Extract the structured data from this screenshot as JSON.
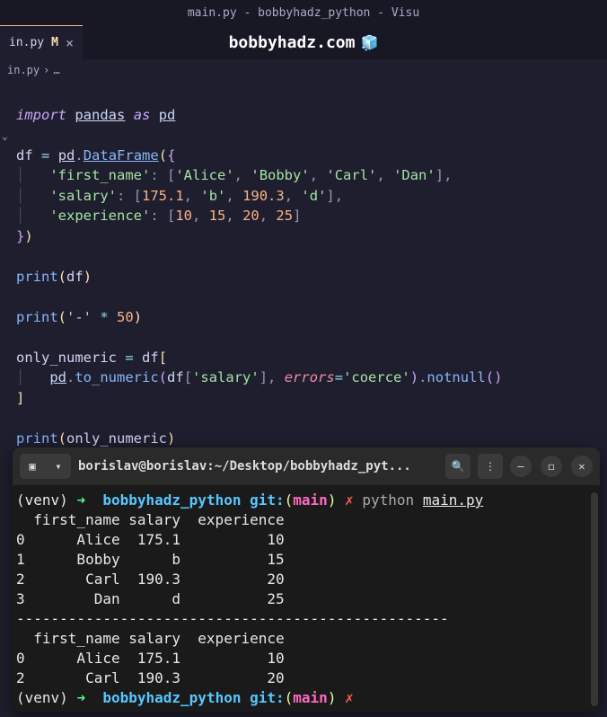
{
  "window": {
    "title": "main.py - bobbyhadz_python - Visu"
  },
  "tab": {
    "filename": "in.py",
    "modified_indicator": "M",
    "close": "×"
  },
  "page_heading": "bobbyhadz.com",
  "breadcrumb": {
    "file": "in.py",
    "sep": "›",
    "more": "…"
  },
  "code": {
    "l1_import": "import",
    "l1_pandas": "pandas",
    "l1_as": "as",
    "l1_pd": "pd",
    "l3_df": "df",
    "l3_eq": "=",
    "l3_pd": "pd",
    "l3_dot": ".",
    "l3_DataFrame": "DataFrame",
    "l3_open": "(",
    "l3_brace": "{",
    "l4_key": "'first_name'",
    "l4_colon": ":",
    "l4_lb": "[",
    "l4_v1": "'Alice'",
    "l4_v2": "'Bobby'",
    "l4_v3": "'Carl'",
    "l4_v4": "'Dan'",
    "l4_rb": "]",
    "l5_key": "'salary'",
    "l5_v1": "175.1",
    "l5_v2": "'b'",
    "l5_v3": "190.3",
    "l5_v4": "'d'",
    "l6_key": "'experience'",
    "l6_v1": "10",
    "l6_v2": "15",
    "l6_v3": "20",
    "l6_v4": "25",
    "l7_brace": "}",
    "l7_close": ")",
    "l9_print": "print",
    "l9_arg": "df",
    "l11_arg": "'-'",
    "l11_mul": "*",
    "l11_fifty": "50",
    "l13_var": "only_numeric",
    "l13_df": "df",
    "l14_pd": "pd",
    "l14_tonum": "to_numeric",
    "l14_df": "df",
    "l14_salary": "'salary'",
    "l14_errors": "errors",
    "l14_coerce": "'coerce'",
    "l14_notnull": "notnull",
    "l17_arg": "only_numeric"
  },
  "terminal": {
    "header_title": "borislav@borislav:~/Desktop/bobbyhadz_pyt...",
    "prompt": {
      "venv": "(venv)",
      "arrow": "➜",
      "dir": "bobbyhadz_python",
      "git": "git:",
      "po": "(",
      "branch": "main",
      "pc": ")",
      "x": "✗",
      "python": "python",
      "script": "main.py"
    },
    "output_header": "  first_name salary  experience",
    "row0": "0      Alice  175.1          10",
    "row1": "1      Bobby      b          15",
    "row2": "2       Carl  190.3          20",
    "row3": "3        Dan      d          25",
    "sep": "--------------------------------------------------",
    "out2_header": "  first_name salary  experience",
    "out2_row0": "0      Alice  175.1          10",
    "out2_row2": "2       Carl  190.3          20"
  }
}
